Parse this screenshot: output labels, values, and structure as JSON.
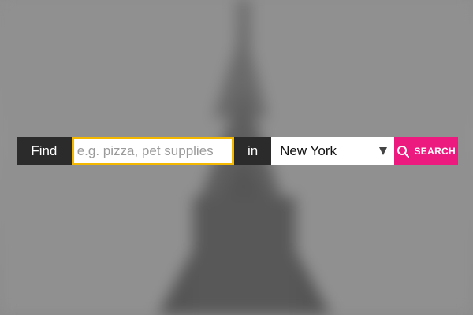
{
  "search": {
    "find_label": "Find",
    "find_placeholder": "e.g. pizza, pet supplies",
    "find_value": "",
    "in_label": "in",
    "location_value": "New York",
    "submit_label": "SEARCH",
    "submit_icon": "search-icon",
    "dropdown_icon": "triangle-down-icon"
  },
  "colors": {
    "label_background": "#2b2b2b",
    "input_focus_border": "#f5b800",
    "accent": "#ec1a7e"
  }
}
